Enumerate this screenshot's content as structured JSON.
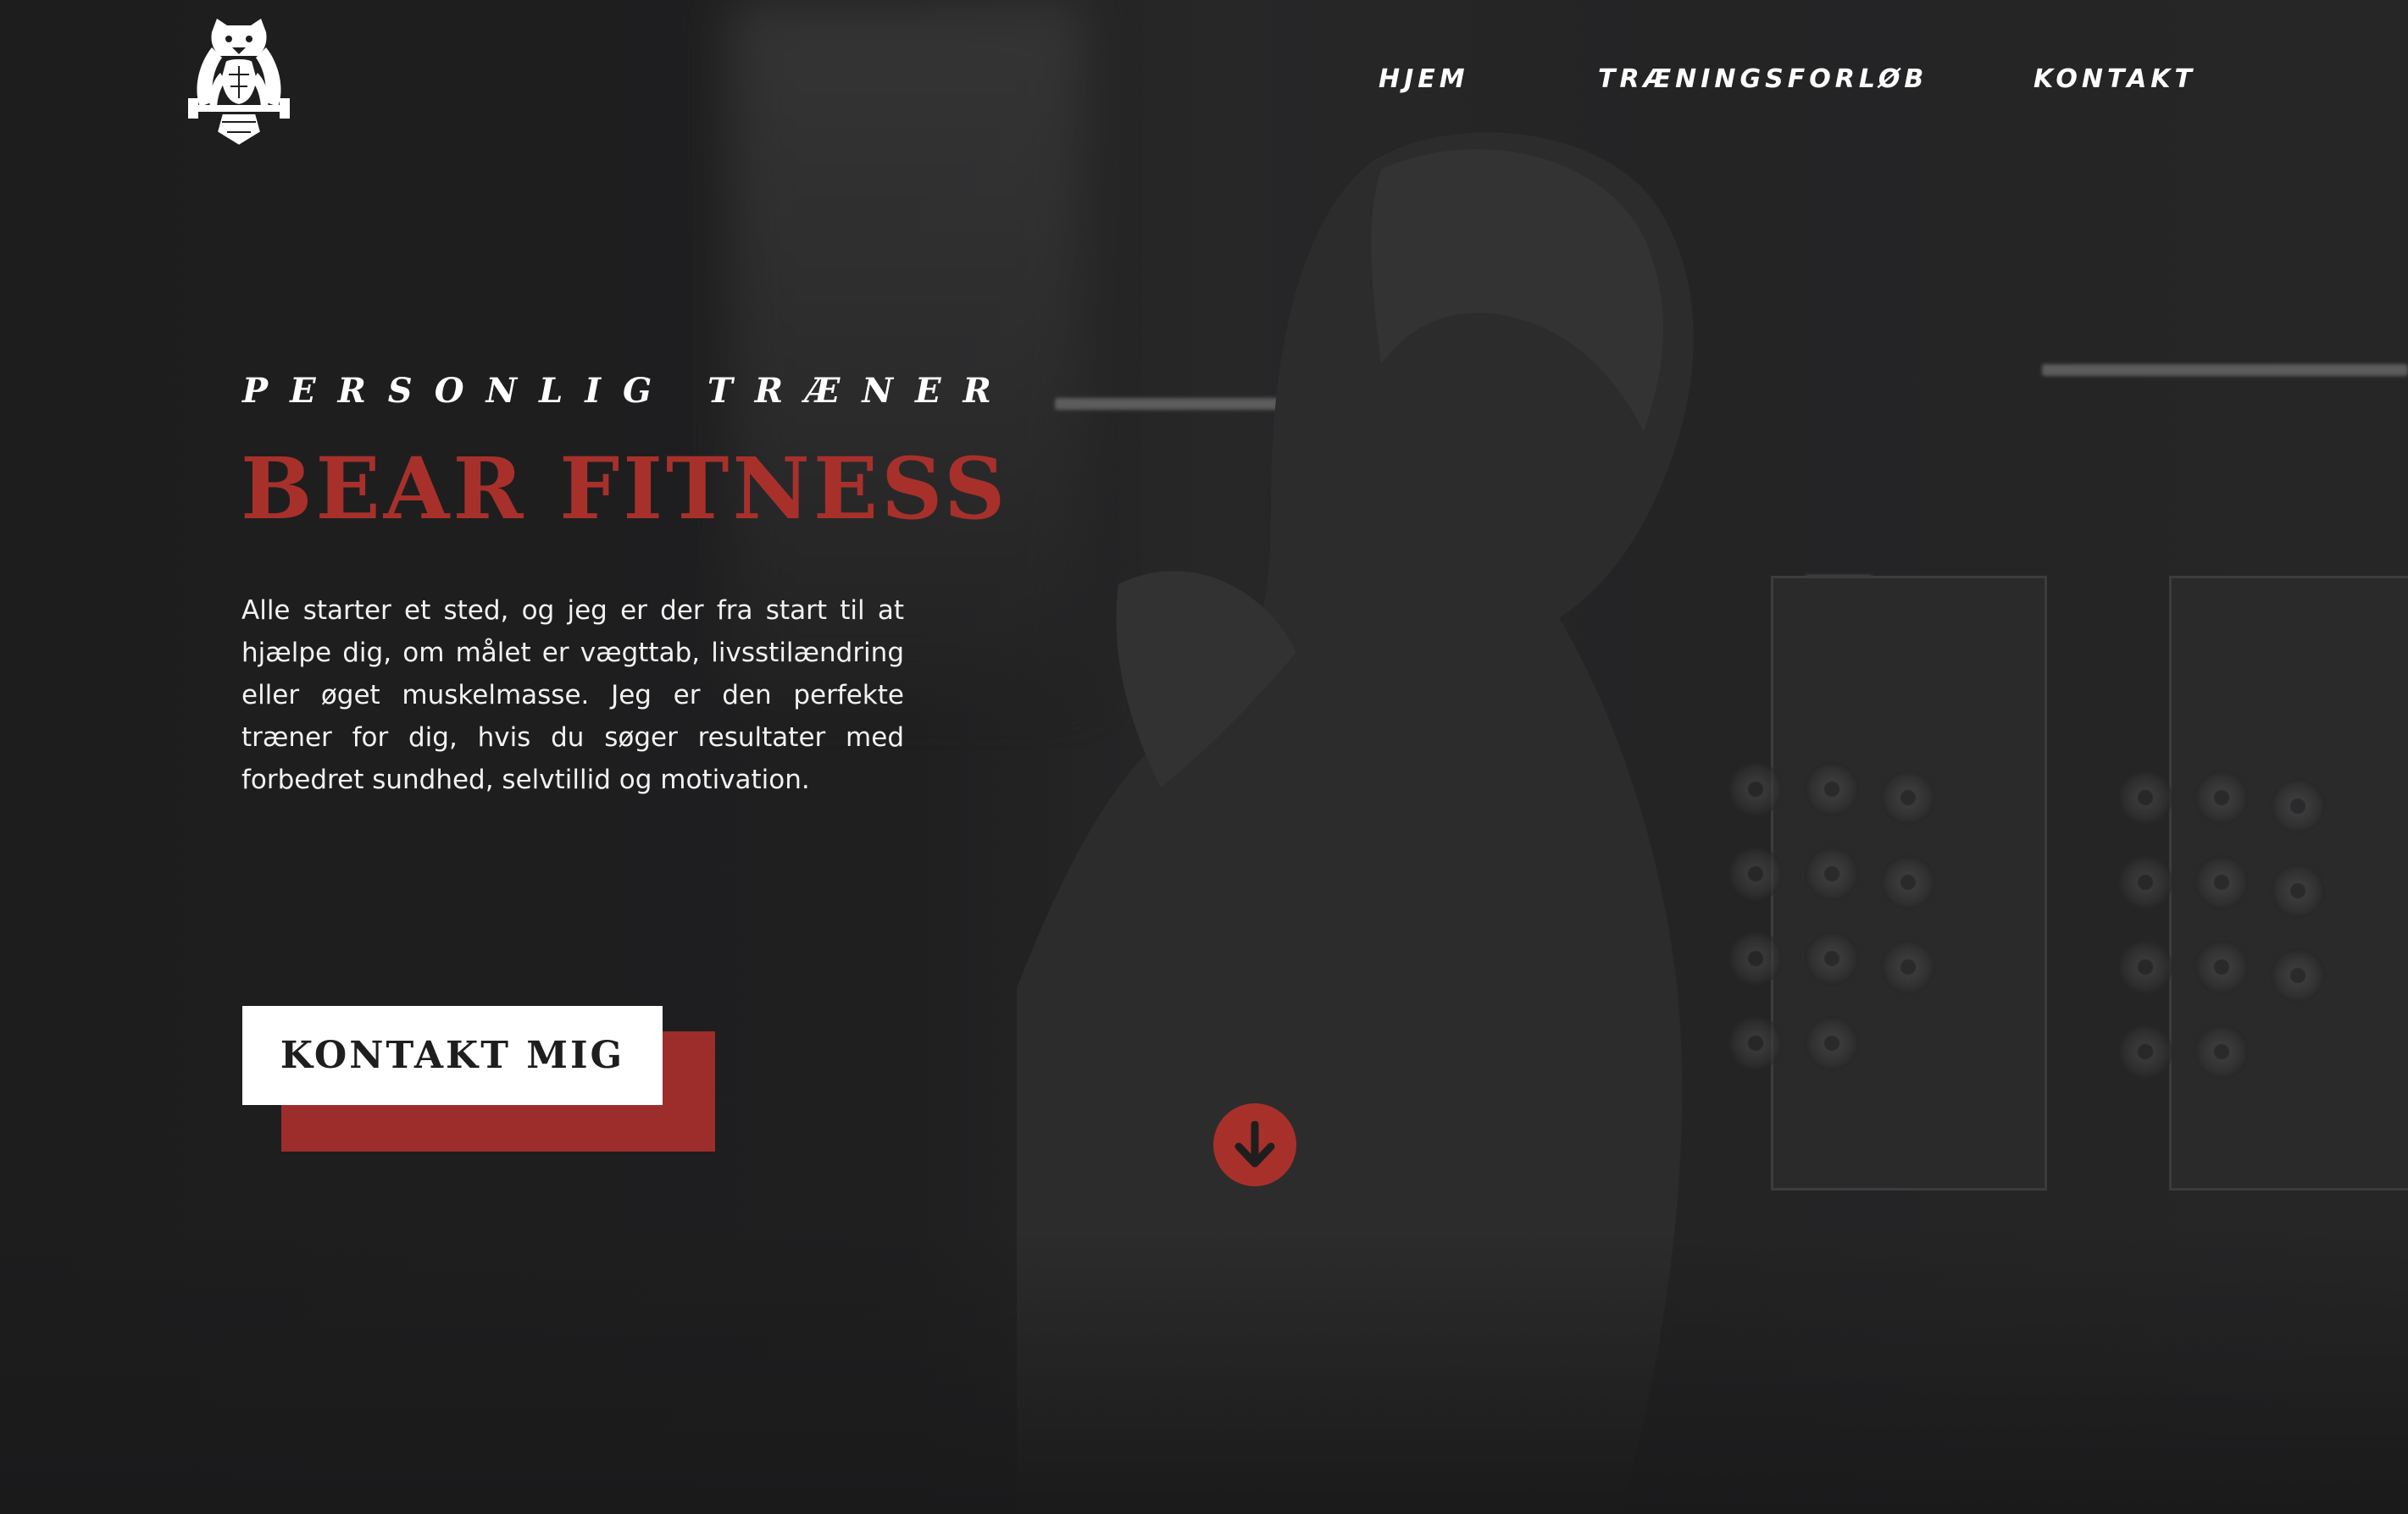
{
  "nav": {
    "items": [
      {
        "label": "HJEM"
      },
      {
        "label": "TRÆNINGSFORLØB"
      },
      {
        "label": "KONTAKT"
      }
    ]
  },
  "logo": {
    "icon": "bear-logo-icon"
  },
  "hero": {
    "subtitle": "PERSONLIG TRÆNER",
    "title": "BEAR FITNESS",
    "intro": "Alle starter et sted, og jeg er der fra start til at hjælpe dig, om målet er vægttab, livsstilændring eller øget muskelmasse. Jeg er den perfekte træner for dig, hvis du søger resultater med forbedret sundhed, selvtillid og motivation.",
    "cta_label": "KONTAKT MIG",
    "scroll_icon": "arrow-down-icon"
  },
  "colors": {
    "background": "#1e1e1f",
    "accent": "#a8302b",
    "cta_shadow": "#9c2d2a",
    "text": "#ffffff"
  }
}
